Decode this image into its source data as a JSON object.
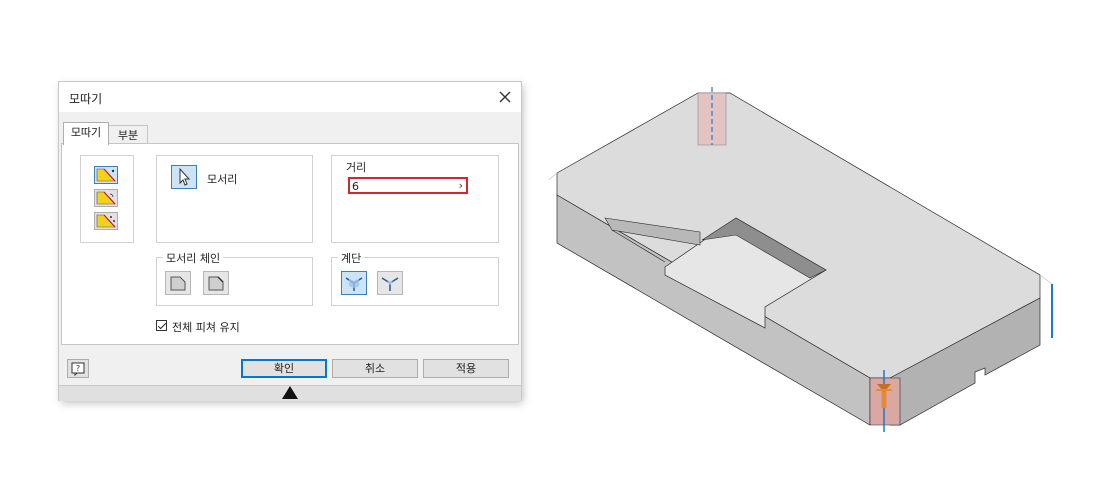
{
  "dialog": {
    "title": "모따기",
    "tabs": [
      {
        "label": "모따기"
      },
      {
        "label": "부분"
      }
    ],
    "edges": {
      "label": "모서리"
    },
    "distance": {
      "label": "거리",
      "value": "6",
      "arrow": "›"
    },
    "edge_chain": {
      "label": "모서리 체인"
    },
    "setback": {
      "label": "계단"
    },
    "preserve": {
      "label": "전체 피쳐 유지",
      "checked": true
    },
    "buttons": {
      "help": "?",
      "ok": "확인",
      "cancel": "취소",
      "apply": "적용"
    }
  },
  "colors": {
    "accent": "#0078d7",
    "selected_bg": "#cde3f7",
    "error_border": "#d3262f",
    "model_top": "#dcdcdc",
    "model_side": "#c4c4c4",
    "model_front": "#a9a9a9",
    "highlight": "#e58a3c"
  },
  "icons": {
    "method_distance": "chamfer-distance-icon",
    "method_distance_angle": "chamfer-distance-angle-icon",
    "method_two_distances": "chamfer-two-distances-icon",
    "edges_select": "cursor-arrow-icon",
    "chain_all": "edge-chain-all-icon",
    "chain_single": "edge-chain-single-icon",
    "setback_all": "setback-corner-icon",
    "setback_other": "setback-vertex-icon",
    "help": "help-icon",
    "close": "close-icon",
    "expand": "expand-triangle-icon"
  }
}
